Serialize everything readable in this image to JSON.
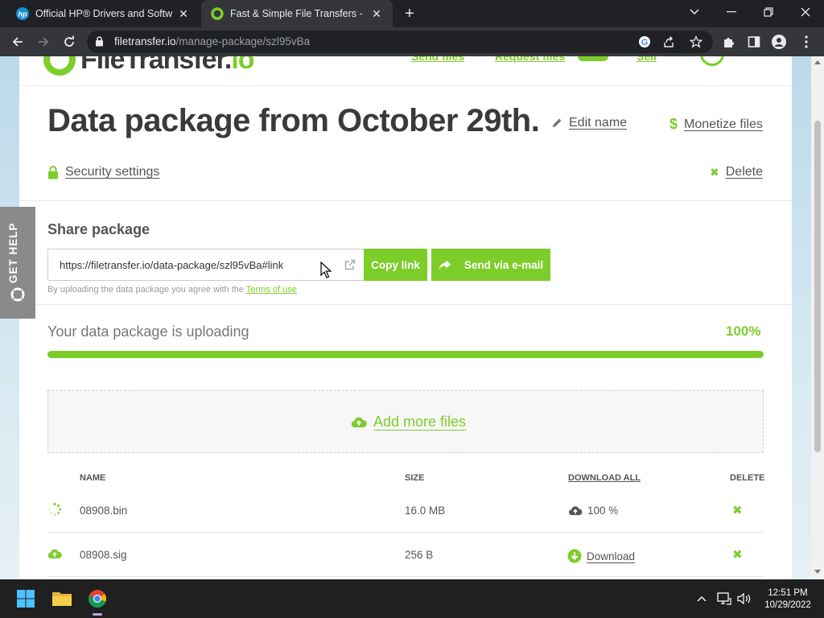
{
  "browser": {
    "tabs": [
      {
        "title": "Official HP® Drivers and Software",
        "active": false
      },
      {
        "title": "Fast & Simple File Transfers - File",
        "active": true
      }
    ],
    "url_host": "filetransfer.io",
    "url_path": "/manage-package/szl95vBa"
  },
  "site": {
    "logo_main": "FileTransfer.",
    "logo_io": "io",
    "nav": [
      "Send files",
      "Request files",
      "Sell"
    ]
  },
  "package": {
    "title": "Data package from October 29th.",
    "edit_name": "Edit name",
    "monetize": "Monetize files",
    "security": "Security settings",
    "delete": "Delete"
  },
  "share": {
    "label": "Share package",
    "link": "https://filetransfer.io/data-package/szl95vBa#link",
    "copy_button": "Copy link",
    "email_button": "Send via e-mail",
    "terms_prefix": "By uploading the data package you agree with the ",
    "terms_link": "Terms of use"
  },
  "upload": {
    "label": "Your data package is uploading",
    "percent_text": "100%",
    "progress": 1.0,
    "add_more": "Add more files"
  },
  "table": {
    "headers": {
      "name": "NAME",
      "size": "SIZE",
      "download_all": "DOWNLOAD ALL",
      "delete": "DELETE"
    },
    "rows": [
      {
        "name": "08908.bin",
        "size": "16.0 MB",
        "status": "100 %",
        "icon": "spinner-icon"
      },
      {
        "name": "08908.sig",
        "size": "256 B",
        "status": "Download",
        "icon": "cloud-upload-icon"
      }
    ]
  },
  "help_tab": "GET HELP",
  "taskbar": {
    "time": "12:51 PM",
    "date": "10/29/2022"
  },
  "colors": {
    "accent": "#7dcd2a",
    "text_dark": "#3a3a3a",
    "chrome_dark": "#202124"
  }
}
